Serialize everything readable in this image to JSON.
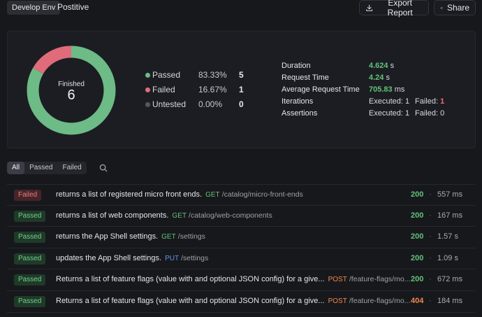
{
  "header": {
    "env": "Develop Env",
    "name": "Postitive",
    "export_label": "Export Report",
    "share_label": "Share"
  },
  "summary": {
    "donut_label": "Finished",
    "donut_total": "6",
    "legend": [
      {
        "label": "Passed",
        "pct": "83.33%",
        "count": "5",
        "color": "#6dbb86"
      },
      {
        "label": "Failed",
        "pct": "16.67%",
        "count": "1",
        "color": "#e06b7a"
      },
      {
        "label": "Untested",
        "pct": "0.00%",
        "count": "0",
        "color": "#555860"
      }
    ],
    "stats": {
      "duration_label": "Duration",
      "duration_value": "4.624",
      "duration_unit": "s",
      "request_time_label": "Request Time",
      "request_time_value": "4.24",
      "request_time_unit": "s",
      "avg_label": "Average Request Time",
      "avg_value": "705.83",
      "avg_unit": "ms",
      "iterations_label": "Iterations",
      "iter_executed_label": "Executed:",
      "iter_executed": "1",
      "iter_failed_label": "Failed:",
      "iter_failed": "1",
      "assertions_label": "Assertions",
      "assert_executed_label": "Executed:",
      "assert_executed": "1",
      "assert_failed_label": "Failed:",
      "assert_failed": "0"
    }
  },
  "filters": {
    "all": "All",
    "passed": "Passed",
    "failed": "Failed"
  },
  "results": [
    {
      "status": "Failed",
      "name": "returns a list of registered micro front ends.",
      "method": "GET",
      "path": "/catalog/micro-front-ends",
      "code": "200",
      "sep": "·",
      "time": "557 ms"
    },
    {
      "status": "Passed",
      "name": "returns a list of web components.",
      "method": "GET",
      "path": "/catalog/web-components",
      "code": "200",
      "sep": "·",
      "time": "167 ms"
    },
    {
      "status": "Passed",
      "name": "returns the App Shell settings.",
      "method": "GET",
      "path": "/settings",
      "code": "200",
      "sep": "·",
      "time": "1.57 s"
    },
    {
      "status": "Passed",
      "name": "updates the App Shell settings.",
      "method": "PUT",
      "path": "/settings",
      "code": "200",
      "sep": "·",
      "time": "1.09 s"
    },
    {
      "status": "Passed",
      "name": "Returns a list of feature flags (value with and optional JSON config) for a give...",
      "method": "POST",
      "path": "/feature-flags/mo...",
      "code": "200",
      "sep": "·",
      "time": "672 ms"
    },
    {
      "status": "Passed",
      "name": "Returns a list of feature flags (value with and optional JSON config) for a give...",
      "method": "POST",
      "path": "/feature-flags/mo...",
      "code": "404",
      "sep": "·",
      "time": "184 ms"
    }
  ]
}
